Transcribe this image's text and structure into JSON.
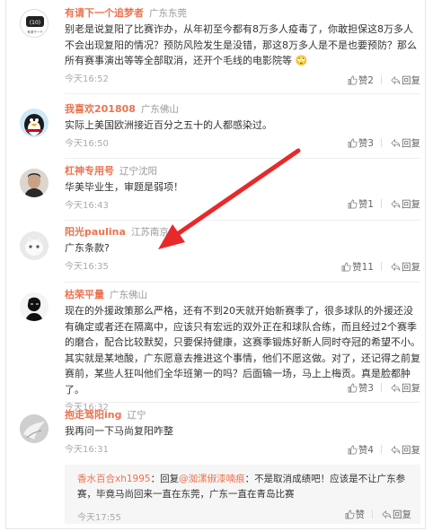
{
  "comments": [
    {
      "user": "有请下一个追梦者",
      "location": "广东东莞",
      "avatar_text": "有请下一个",
      "text": "别老是说复阳了比赛诈办，从年初至今都有8万多人疫毒了，你敢担保这8万多人不会出现复阳的情况？预防风险发生是没错，那这8万多人是不是也要预防？那么所有赛事演出等等全部取消，还开个毛线的电影院等",
      "emoji": "🙄",
      "time": "今天16:52",
      "likes": "赞2",
      "reply": "回复"
    },
    {
      "user": "我喜欢201808",
      "location": "广东佛山",
      "text": "实际上美国欧洲接近百分之五十的人都感染过。",
      "time": "今天16:50",
      "likes": "赞3",
      "reply": "回复"
    },
    {
      "user": "杠神专用号",
      "location": "辽宁沈阳",
      "text": "华美毕业生，审题是弱项！",
      "time": "今天16:43",
      "likes": "赞1",
      "reply": "回复"
    },
    {
      "user": "阳光paulina",
      "location": "江苏南京",
      "text": "广东条款?",
      "time": "今天16:35",
      "likes": "赞11",
      "reply": "回复"
    },
    {
      "user": "枯荣平量",
      "location": "广东佛山",
      "text": "现在的外援政策那么严格，还有不到20天就开始新赛季了，很多球队的外援还没有确定或者还在隔离中，应该只有宏远的双外正在和球队合练，而且经过2个赛季的磨合，配合比较默契，只要保持健康，这赛季锻炼好新人同时夺冠的希望不小。其实就是某地酸，广东愿意去推进这个事情，他们不愿这做。对了，还记得之前复赛前，某些人狂叫他们全华班第一的吗？后面输一场，马上上梅贡。真是脸都肿了。",
      "time": "今天16:32",
      "likes": "赞3",
      "reply": "回复"
    },
    {
      "user": "抱走驾阳ing",
      "location": "辽宁",
      "text": "我再问一下马尚复阳咋整",
      "time": "今天16:31",
      "likes": "赞4",
      "reply": "回复"
    }
  ],
  "sub_reply": {
    "user": "香水百合xh1995",
    "prefix": "：回复",
    "mention": "@洳漯俶漆喃痕",
    "text": "：不是取消成绩吧！应该是不让广东参赛，毕竟马尚回来一直在东莞，广东一直在青岛比赛",
    "time": "今天17:55",
    "likes": "赞",
    "reply": "回复"
  },
  "colors": {
    "accent": "#eb7350",
    "arrow": "#e8292a"
  }
}
